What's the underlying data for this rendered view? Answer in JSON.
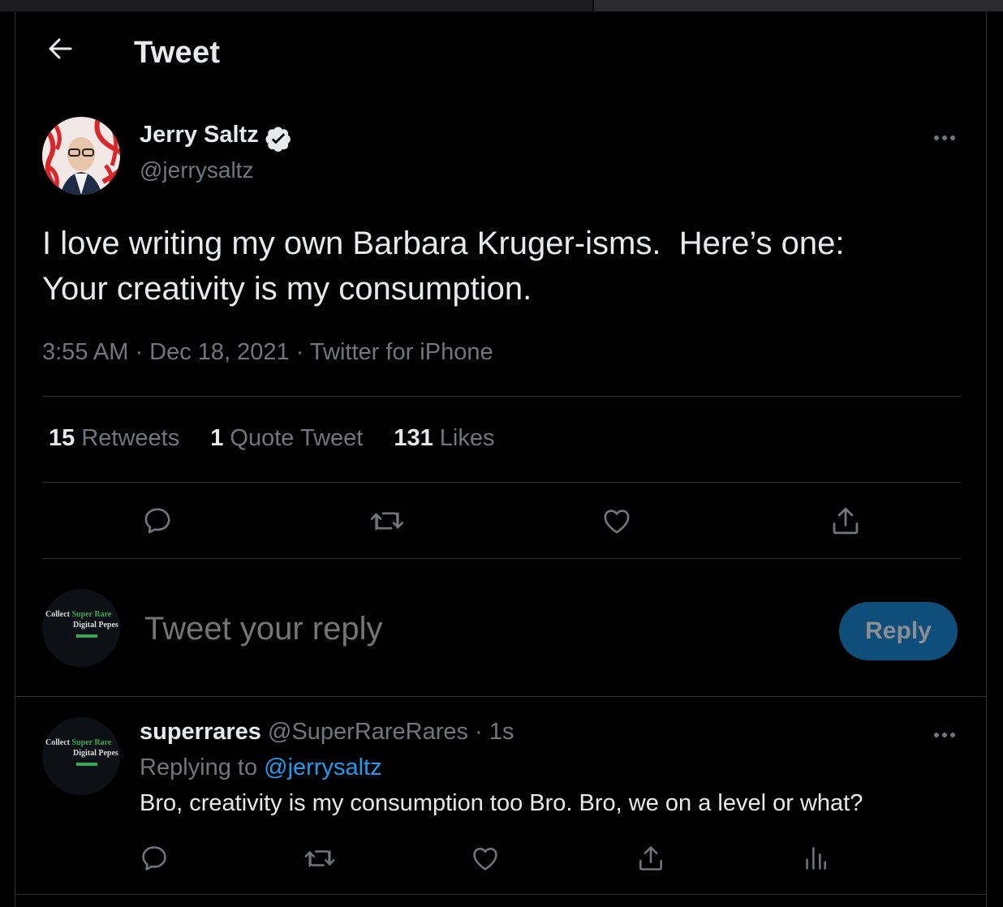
{
  "header": {
    "title": "Tweet"
  },
  "tweet": {
    "author_name": "Jerry Saltz",
    "author_handle": "@jerrysaltz",
    "text": "I love writing my own Barbara Kruger-isms.  Here’s one:\nYour creativity is my consumption.",
    "meta": "3:55 AM · Dec 18, 2021 · Twitter for iPhone",
    "stats": {
      "retweets_count": "15",
      "retweets_label": "Retweets",
      "quotes_count": "1",
      "quotes_label": "Quote Tweet",
      "likes_count": "131",
      "likes_label": "Likes"
    }
  },
  "composer": {
    "placeholder": "Tweet your reply",
    "button_label": "Reply",
    "avatar_text_1": "Collect",
    "avatar_text_2": "Super Rare",
    "avatar_text_3": "Digital Pepes"
  },
  "reply": {
    "name": "superrares",
    "handle": "@SuperRareRares",
    "time": "· 1s",
    "replying_to_label": "Replying to",
    "replying_to_handle": "@jerrysaltz",
    "text": "Bro, creativity is my consumption too Bro. Bro, we on a level or what?"
  },
  "colors": {
    "background": "#000000",
    "primary_text": "#e7e9ea",
    "secondary_text": "#71767b",
    "accent": "#1d9bf0",
    "reply_button_disabled": "#0f4e7a",
    "divider": "#2f3336"
  }
}
